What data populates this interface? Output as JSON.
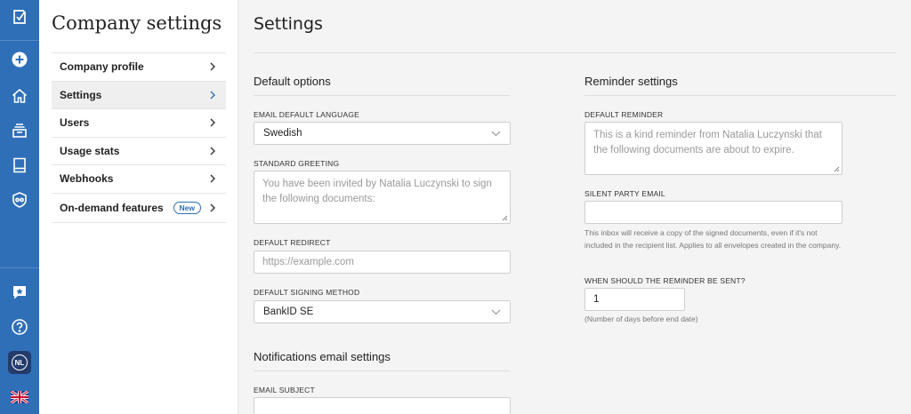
{
  "rail": {
    "top_icons": [
      "logo-icon",
      "plus-circle-icon",
      "home-icon",
      "archive-icon",
      "book-icon",
      "shield-icon"
    ],
    "bottom_icons": [
      "star-chat-icon",
      "help-icon"
    ],
    "avatar_initials": "NL",
    "accent": "#2f6fb8"
  },
  "sidenav": {
    "title": "Company settings",
    "items": [
      {
        "label": "Company profile"
      },
      {
        "label": "Settings"
      },
      {
        "label": "Users"
      },
      {
        "label": "Usage stats"
      },
      {
        "label": "Webhooks"
      },
      {
        "label": "On-demand features",
        "badge": "New"
      }
    ]
  },
  "main": {
    "title": "Settings",
    "default_options": {
      "title": "Default options",
      "email_language_label": "EMAIL DEFAULT LANGUAGE",
      "email_language_value": "Swedish",
      "greeting_label": "STANDARD GREETING",
      "greeting_placeholder": "You have been invited by Natalia Luczynski to sign the following documents:",
      "redirect_label": "DEFAULT REDIRECT",
      "redirect_placeholder": "https://example.com",
      "signing_method_label": "DEFAULT SIGNING METHOD",
      "signing_method_value": "BankID SE"
    },
    "notifications": {
      "title": "Notifications email settings",
      "subject_label": "EMAIL SUBJECT"
    },
    "reminder": {
      "title": "Reminder settings",
      "default_reminder_label": "DEFAULT REMINDER",
      "default_reminder_placeholder": "This is a kind reminder from Natalia Luczynski that the following documents are about to expire.",
      "silent_email_label": "SILENT PARTY EMAIL",
      "silent_email_help": "This inbox will receive a copy of the signed documents, even if it's not included in the recipient list. Applies to all envelopes created in the company.",
      "when_label": "WHEN SHOULD THE REMINDER BE SENT?",
      "when_value": "1",
      "when_help": "(Number of days before end date)"
    }
  }
}
